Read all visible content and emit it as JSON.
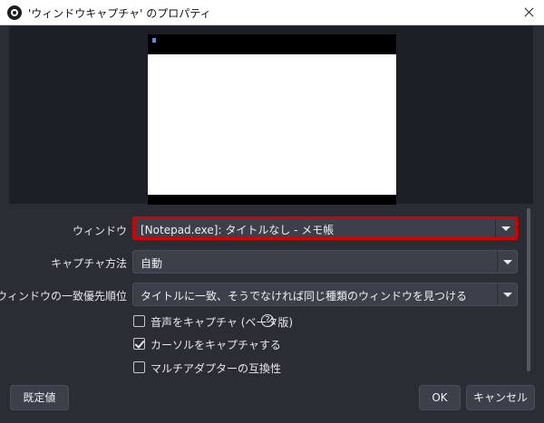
{
  "window": {
    "title": "'ウィンドウキャプチャ' のプロパティ",
    "icon": "obs-logo-icon",
    "close_icon": "close-icon"
  },
  "form": {
    "window": {
      "label": "ウィンドウ",
      "value": "[Notepad.exe]: タイトルなし - メモ帳"
    },
    "capture_method": {
      "label": "キャプチャ方法",
      "value": "自動"
    },
    "match_priority": {
      "label": "ウィンドウの一致優先順位",
      "value": "タイトルに一致、そうでなければ同じ種類のウィンドウを見つける"
    },
    "capture_audio": {
      "label": "音声をキャプチャ (ベータ版)",
      "checked": false,
      "help_icon": "?"
    },
    "capture_cursor": {
      "label": "カーソルをキャプチャする",
      "checked": true
    },
    "multi_adapter": {
      "label": "マルチアダプターの互換性",
      "checked": false
    }
  },
  "buttons": {
    "defaults": "既定値",
    "ok": "OK",
    "cancel": "キャンセル"
  },
  "colors": {
    "background": "#2b2d35",
    "field": "#3c404b",
    "highlight_border": "#d60000"
  }
}
